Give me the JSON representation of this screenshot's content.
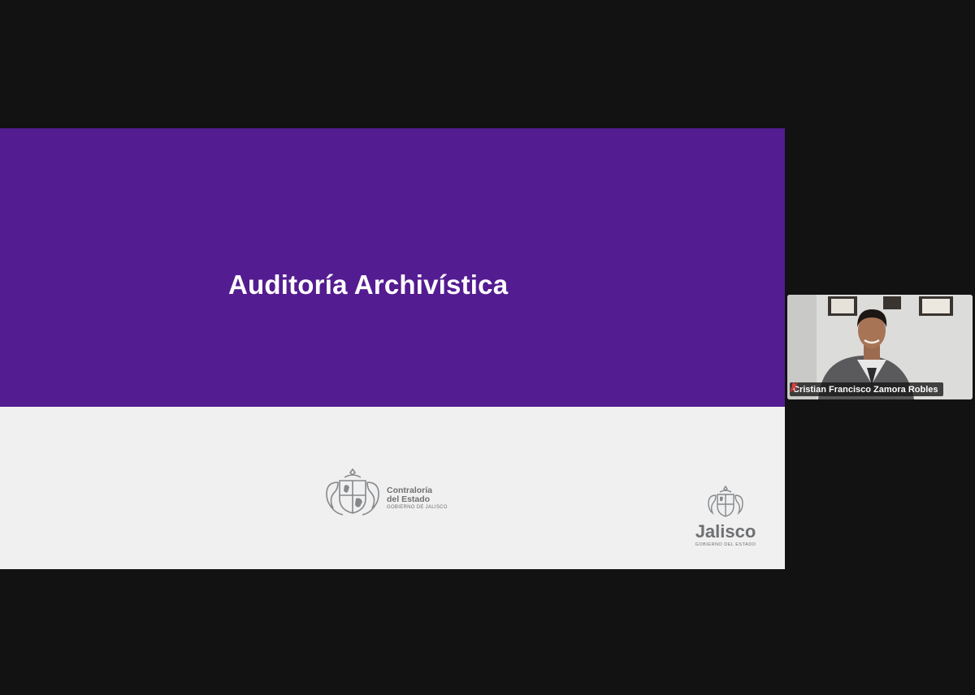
{
  "slide": {
    "title": "Auditoría Archivística",
    "band_color": "#541c91",
    "background_color": "#f0f0f0",
    "logos": {
      "contraloria": {
        "line1": "Contraloría",
        "line2": "del Estado",
        "line3": "GOBIERNO DE JALISCO"
      },
      "jalisco": {
        "word": "Jalisco",
        "sub": "GOBIERNO DEL ESTADO"
      }
    }
  },
  "participant": {
    "name": "Cristian Francisco Zamora Robles",
    "mic_icon": "mic-muted-icon",
    "mic_color": "#e0403a"
  }
}
